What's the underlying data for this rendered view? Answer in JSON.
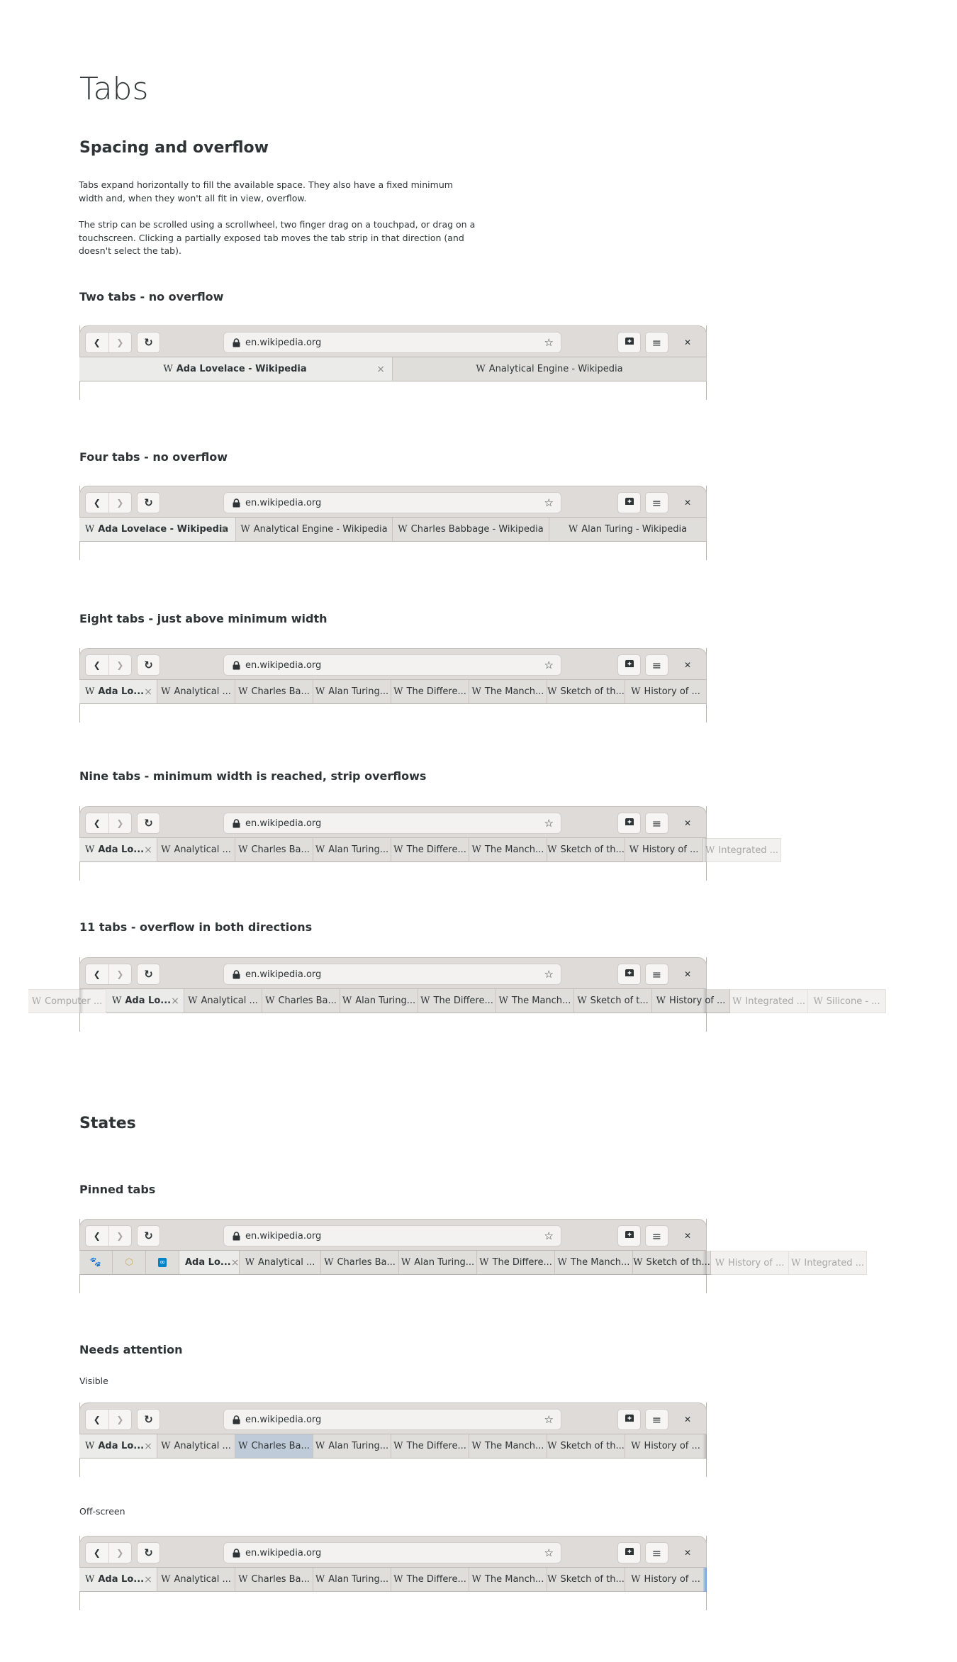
{
  "page": {
    "title": "Tabs",
    "section1": {
      "heading": "Spacing and overflow",
      "paragraph1": "Tabs expand horizontally to fill the available space. They also have a fixed minimum width and, when they won't all fit in view, overflow.",
      "paragraph2": "The strip can be scrolled using a scrollwheel, two finger drag on a touchpad, or drag on a touchscreen. Clicking a partially exposed tab moves the tab strip in that direction (and doesn't select the tab)."
    },
    "section2": {
      "heading": "States"
    }
  },
  "browser_common": {
    "back_icon": "chevron-left-icon",
    "forward_icon": "chevron-right-icon",
    "reload_icon": "reload-icon",
    "lock_icon": "lock-icon",
    "url": "en.wikipedia.org",
    "bookmark_icon": "star-icon",
    "new_tab_icon": "new-tab-icon",
    "menu_icon": "hamburger-menu-icon",
    "close_icon": "close-icon",
    "site_icon_glyph": "W",
    "tab_close_glyph": "×"
  },
  "colors": {
    "header_bg": "#dedbd8",
    "tab_bg": "#e0dedb",
    "active_tab_bg": "#ebebea",
    "overflow_tab_bg": "#f2f1f0",
    "attention_tab_bg": "#c0cbd9",
    "attention_edge": "#6f9ee0"
  },
  "examples": [
    {
      "heading": "Two tabs - no overflow",
      "tabs": [
        {
          "title": "Ada Lovelace - Wikipedia",
          "active": true
        },
        {
          "title": "Analytical Engine - Wikipedia"
        }
      ]
    },
    {
      "heading": "Four tabs - no overflow",
      "tabs": [
        {
          "title": "Ada Lovelace - Wikipedia",
          "active": true
        },
        {
          "title": "Analytical Engine - Wikipedia"
        },
        {
          "title": "Charles Babbage - Wikipedia"
        },
        {
          "title": "Alan Turing - Wikipedia"
        }
      ]
    },
    {
      "heading": "Eight tabs - just above minimum width",
      "tabs": [
        {
          "title": "Ada Lo...",
          "active": true
        },
        {
          "title": "Analytical ..."
        },
        {
          "title": "Charles Ba..."
        },
        {
          "title": "Alan Turing..."
        },
        {
          "title": "The Differe..."
        },
        {
          "title": "The Manch..."
        },
        {
          "title": "Sketch of th..."
        },
        {
          "title": "History of ..."
        }
      ]
    },
    {
      "heading": "Nine tabs - minimum width is reached, strip overflows",
      "tabs": [
        {
          "title": "Ada Lo...",
          "active": true
        },
        {
          "title": "Analytical ..."
        },
        {
          "title": "Charles Ba..."
        },
        {
          "title": "Alan Turing..."
        },
        {
          "title": "The Differe..."
        },
        {
          "title": "The Manch..."
        },
        {
          "title": "Sketch of th..."
        },
        {
          "title": "History of ..."
        },
        {
          "title": "Integrated ...",
          "overflow": true
        }
      ]
    },
    {
      "heading": "11 tabs - overflow in both directions",
      "tabs": [
        {
          "title": "Computer ...",
          "overflow": true
        },
        {
          "title": "Ada Lo...",
          "active": true
        },
        {
          "title": "Analytical ..."
        },
        {
          "title": "Charles Ba..."
        },
        {
          "title": "Alan Turing..."
        },
        {
          "title": "The Differe..."
        },
        {
          "title": "The Manch..."
        },
        {
          "title": "Sketch of t..."
        },
        {
          "title": "History of ..."
        },
        {
          "title": "Integrated ...",
          "overflow": true
        },
        {
          "title": "Silicone - ...",
          "overflow": true
        }
      ]
    },
    {
      "heading": "Pinned tabs",
      "tabs": [
        {
          "pinned": true,
          "icon": "gnome-foot-icon"
        },
        {
          "pinned": true,
          "icon": "package-icon"
        },
        {
          "pinned": true,
          "icon": "nextcloud-icon"
        },
        {
          "title": "Ada Lo...",
          "active": true,
          "no_site_icon": true
        },
        {
          "title": "Analytical ..."
        },
        {
          "title": "Charles Ba..."
        },
        {
          "title": "Alan Turing..."
        },
        {
          "title": "The Differe..."
        },
        {
          "title": "The Manch..."
        },
        {
          "title": "Sketch of th..."
        },
        {
          "title": "History of ...",
          "overflow": true
        },
        {
          "title": "Integrated ...",
          "overflow": true
        }
      ]
    },
    {
      "heading": "Needs attention",
      "subheading": "Visible",
      "tabs": [
        {
          "title": "Ada Lo...",
          "active": true
        },
        {
          "title": "Analytical ..."
        },
        {
          "title": "Charles Ba...",
          "attention": true
        },
        {
          "title": "Alan Turing..."
        },
        {
          "title": "The Differe..."
        },
        {
          "title": "The Manch..."
        },
        {
          "title": "Sketch of th..."
        },
        {
          "title": "History of ..."
        }
      ]
    },
    {
      "subheading": "Off-screen",
      "attention_offscreen": "right",
      "tabs": [
        {
          "title": "Ada Lo...",
          "active": true
        },
        {
          "title": "Analytical ..."
        },
        {
          "title": "Charles Ba..."
        },
        {
          "title": "Alan Turing..."
        },
        {
          "title": "The Differe..."
        },
        {
          "title": "The Manch..."
        },
        {
          "title": "Sketch of th..."
        },
        {
          "title": "History of ..."
        }
      ]
    }
  ]
}
